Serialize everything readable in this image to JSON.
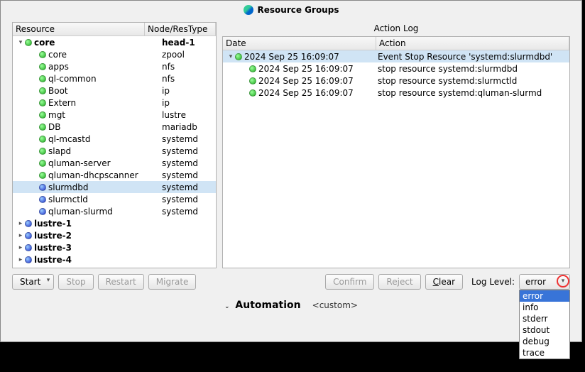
{
  "title": "Resource Groups",
  "tree": {
    "headers": {
      "resource": "Resource",
      "node": "Node/ResType"
    },
    "rows": [
      {
        "indent": 0,
        "arrow": "▾",
        "dot": "green",
        "name": "core",
        "node": "head-1",
        "bold": true
      },
      {
        "indent": 1,
        "arrow": "",
        "dot": "green",
        "name": "core",
        "node": "zpool"
      },
      {
        "indent": 1,
        "arrow": "",
        "dot": "green",
        "name": "apps",
        "node": "nfs"
      },
      {
        "indent": 1,
        "arrow": "",
        "dot": "green",
        "name": "ql-common",
        "node": "nfs"
      },
      {
        "indent": 1,
        "arrow": "",
        "dot": "green",
        "name": "Boot",
        "node": "ip"
      },
      {
        "indent": 1,
        "arrow": "",
        "dot": "green",
        "name": "Extern",
        "node": "ip"
      },
      {
        "indent": 1,
        "arrow": "",
        "dot": "green",
        "name": "mgt",
        "node": "lustre"
      },
      {
        "indent": 1,
        "arrow": "",
        "dot": "green",
        "name": "DB",
        "node": "mariadb"
      },
      {
        "indent": 1,
        "arrow": "",
        "dot": "green",
        "name": "ql-mcastd",
        "node": "systemd"
      },
      {
        "indent": 1,
        "arrow": "",
        "dot": "green",
        "name": "slapd",
        "node": "systemd"
      },
      {
        "indent": 1,
        "arrow": "",
        "dot": "green",
        "name": "qluman-server",
        "node": "systemd"
      },
      {
        "indent": 1,
        "arrow": "",
        "dot": "green",
        "name": "qluman-dhcpscanner",
        "node": "systemd"
      },
      {
        "indent": 1,
        "arrow": "",
        "dot": "blue",
        "name": "slurmdbd",
        "node": "systemd",
        "selected": true
      },
      {
        "indent": 1,
        "arrow": "",
        "dot": "blue",
        "name": "slurmctld",
        "node": "systemd"
      },
      {
        "indent": 1,
        "arrow": "",
        "dot": "blue",
        "name": "qluman-slurmd",
        "node": "systemd"
      },
      {
        "indent": 0,
        "arrow": "▸",
        "dot": "blue",
        "name": "lustre-1",
        "node": "",
        "bold": true
      },
      {
        "indent": 0,
        "arrow": "▸",
        "dot": "blue",
        "name": "lustre-2",
        "node": "",
        "bold": true
      },
      {
        "indent": 0,
        "arrow": "▸",
        "dot": "blue",
        "name": "lustre-3",
        "node": "",
        "bold": true
      },
      {
        "indent": 0,
        "arrow": "▸",
        "dot": "blue",
        "name": "lustre-4",
        "node": "",
        "bold": true
      }
    ]
  },
  "log": {
    "title": "Action Log",
    "headers": {
      "date": "Date",
      "action": "Action"
    },
    "rows": [
      {
        "indent": 0,
        "arrow": "▾",
        "dot": "green",
        "date": "2024 Sep 25 16:09:07",
        "action": "Event Stop Resource 'systemd:slurmdbd'",
        "selected": true
      },
      {
        "indent": 1,
        "arrow": "",
        "dot": "green",
        "date": "2024 Sep 25 16:09:07",
        "action": "stop resource systemd:slurmdbd"
      },
      {
        "indent": 1,
        "arrow": "",
        "dot": "green",
        "date": "2024 Sep 25 16:09:07",
        "action": "stop resource systemd:slurmctld"
      },
      {
        "indent": 1,
        "arrow": "",
        "dot": "green",
        "date": "2024 Sep 25 16:09:07",
        "action": "stop resource systemd:qluman-slurmd"
      }
    ]
  },
  "buttons": {
    "start": "Start",
    "stop": "Stop",
    "restart": "Restart",
    "migrate": "Migrate",
    "confirm": "Confirm",
    "reject": "Reject",
    "clear": "Clear"
  },
  "log_level": {
    "label": "Log Level:",
    "value": "error",
    "options": [
      "error",
      "info",
      "stderr",
      "stdout",
      "debug",
      "trace"
    ]
  },
  "automation": {
    "label": "Automation",
    "value": "<custom>"
  }
}
